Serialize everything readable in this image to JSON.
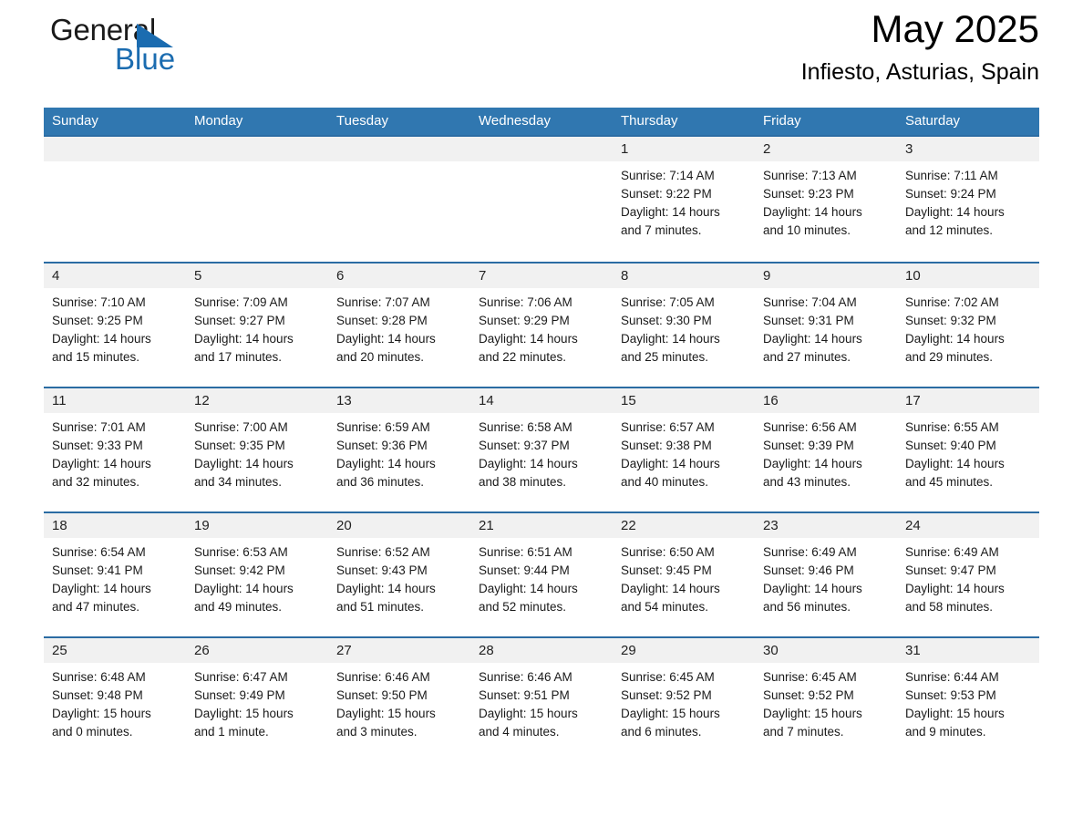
{
  "brand": {
    "name_dark": "General",
    "name_light": "Blue",
    "triangle_color": "#1b6cb0"
  },
  "header": {
    "title": "May 2025",
    "subtitle": "Infiesto, Asturias, Spain",
    "accent_color": "#3077b0",
    "separator_color": "#2b6ca3",
    "day_band_color": "#f1f1f1"
  },
  "weekday_headers": [
    "Sunday",
    "Monday",
    "Tuesday",
    "Wednesday",
    "Thursday",
    "Friday",
    "Saturday"
  ],
  "weeks": [
    {
      "days": [
        {
          "num": "",
          "sunrise": "",
          "sunset": "",
          "daylight_1": "",
          "daylight_2": ""
        },
        {
          "num": "",
          "sunrise": "",
          "sunset": "",
          "daylight_1": "",
          "daylight_2": ""
        },
        {
          "num": "",
          "sunrise": "",
          "sunset": "",
          "daylight_1": "",
          "daylight_2": ""
        },
        {
          "num": "",
          "sunrise": "",
          "sunset": "",
          "daylight_1": "",
          "daylight_2": ""
        },
        {
          "num": "1",
          "sunrise": "Sunrise: 7:14 AM",
          "sunset": "Sunset: 9:22 PM",
          "daylight_1": "Daylight: 14 hours",
          "daylight_2": "and 7 minutes."
        },
        {
          "num": "2",
          "sunrise": "Sunrise: 7:13 AM",
          "sunset": "Sunset: 9:23 PM",
          "daylight_1": "Daylight: 14 hours",
          "daylight_2": "and 10 minutes."
        },
        {
          "num": "3",
          "sunrise": "Sunrise: 7:11 AM",
          "sunset": "Sunset: 9:24 PM",
          "daylight_1": "Daylight: 14 hours",
          "daylight_2": "and 12 minutes."
        }
      ]
    },
    {
      "days": [
        {
          "num": "4",
          "sunrise": "Sunrise: 7:10 AM",
          "sunset": "Sunset: 9:25 PM",
          "daylight_1": "Daylight: 14 hours",
          "daylight_2": "and 15 minutes."
        },
        {
          "num": "5",
          "sunrise": "Sunrise: 7:09 AM",
          "sunset": "Sunset: 9:27 PM",
          "daylight_1": "Daylight: 14 hours",
          "daylight_2": "and 17 minutes."
        },
        {
          "num": "6",
          "sunrise": "Sunrise: 7:07 AM",
          "sunset": "Sunset: 9:28 PM",
          "daylight_1": "Daylight: 14 hours",
          "daylight_2": "and 20 minutes."
        },
        {
          "num": "7",
          "sunrise": "Sunrise: 7:06 AM",
          "sunset": "Sunset: 9:29 PM",
          "daylight_1": "Daylight: 14 hours",
          "daylight_2": "and 22 minutes."
        },
        {
          "num": "8",
          "sunrise": "Sunrise: 7:05 AM",
          "sunset": "Sunset: 9:30 PM",
          "daylight_1": "Daylight: 14 hours",
          "daylight_2": "and 25 minutes."
        },
        {
          "num": "9",
          "sunrise": "Sunrise: 7:04 AM",
          "sunset": "Sunset: 9:31 PM",
          "daylight_1": "Daylight: 14 hours",
          "daylight_2": "and 27 minutes."
        },
        {
          "num": "10",
          "sunrise": "Sunrise: 7:02 AM",
          "sunset": "Sunset: 9:32 PM",
          "daylight_1": "Daylight: 14 hours",
          "daylight_2": "and 29 minutes."
        }
      ]
    },
    {
      "days": [
        {
          "num": "11",
          "sunrise": "Sunrise: 7:01 AM",
          "sunset": "Sunset: 9:33 PM",
          "daylight_1": "Daylight: 14 hours",
          "daylight_2": "and 32 minutes."
        },
        {
          "num": "12",
          "sunrise": "Sunrise: 7:00 AM",
          "sunset": "Sunset: 9:35 PM",
          "daylight_1": "Daylight: 14 hours",
          "daylight_2": "and 34 minutes."
        },
        {
          "num": "13",
          "sunrise": "Sunrise: 6:59 AM",
          "sunset": "Sunset: 9:36 PM",
          "daylight_1": "Daylight: 14 hours",
          "daylight_2": "and 36 minutes."
        },
        {
          "num": "14",
          "sunrise": "Sunrise: 6:58 AM",
          "sunset": "Sunset: 9:37 PM",
          "daylight_1": "Daylight: 14 hours",
          "daylight_2": "and 38 minutes."
        },
        {
          "num": "15",
          "sunrise": "Sunrise: 6:57 AM",
          "sunset": "Sunset: 9:38 PM",
          "daylight_1": "Daylight: 14 hours",
          "daylight_2": "and 40 minutes."
        },
        {
          "num": "16",
          "sunrise": "Sunrise: 6:56 AM",
          "sunset": "Sunset: 9:39 PM",
          "daylight_1": "Daylight: 14 hours",
          "daylight_2": "and 43 minutes."
        },
        {
          "num": "17",
          "sunrise": "Sunrise: 6:55 AM",
          "sunset": "Sunset: 9:40 PM",
          "daylight_1": "Daylight: 14 hours",
          "daylight_2": "and 45 minutes."
        }
      ]
    },
    {
      "days": [
        {
          "num": "18",
          "sunrise": "Sunrise: 6:54 AM",
          "sunset": "Sunset: 9:41 PM",
          "daylight_1": "Daylight: 14 hours",
          "daylight_2": "and 47 minutes."
        },
        {
          "num": "19",
          "sunrise": "Sunrise: 6:53 AM",
          "sunset": "Sunset: 9:42 PM",
          "daylight_1": "Daylight: 14 hours",
          "daylight_2": "and 49 minutes."
        },
        {
          "num": "20",
          "sunrise": "Sunrise: 6:52 AM",
          "sunset": "Sunset: 9:43 PM",
          "daylight_1": "Daylight: 14 hours",
          "daylight_2": "and 51 minutes."
        },
        {
          "num": "21",
          "sunrise": "Sunrise: 6:51 AM",
          "sunset": "Sunset: 9:44 PM",
          "daylight_1": "Daylight: 14 hours",
          "daylight_2": "and 52 minutes."
        },
        {
          "num": "22",
          "sunrise": "Sunrise: 6:50 AM",
          "sunset": "Sunset: 9:45 PM",
          "daylight_1": "Daylight: 14 hours",
          "daylight_2": "and 54 minutes."
        },
        {
          "num": "23",
          "sunrise": "Sunrise: 6:49 AM",
          "sunset": "Sunset: 9:46 PM",
          "daylight_1": "Daylight: 14 hours",
          "daylight_2": "and 56 minutes."
        },
        {
          "num": "24",
          "sunrise": "Sunrise: 6:49 AM",
          "sunset": "Sunset: 9:47 PM",
          "daylight_1": "Daylight: 14 hours",
          "daylight_2": "and 58 minutes."
        }
      ]
    },
    {
      "days": [
        {
          "num": "25",
          "sunrise": "Sunrise: 6:48 AM",
          "sunset": "Sunset: 9:48 PM",
          "daylight_1": "Daylight: 15 hours",
          "daylight_2": "and 0 minutes."
        },
        {
          "num": "26",
          "sunrise": "Sunrise: 6:47 AM",
          "sunset": "Sunset: 9:49 PM",
          "daylight_1": "Daylight: 15 hours",
          "daylight_2": "and 1 minute."
        },
        {
          "num": "27",
          "sunrise": "Sunrise: 6:46 AM",
          "sunset": "Sunset: 9:50 PM",
          "daylight_1": "Daylight: 15 hours",
          "daylight_2": "and 3 minutes."
        },
        {
          "num": "28",
          "sunrise": "Sunrise: 6:46 AM",
          "sunset": "Sunset: 9:51 PM",
          "daylight_1": "Daylight: 15 hours",
          "daylight_2": "and 4 minutes."
        },
        {
          "num": "29",
          "sunrise": "Sunrise: 6:45 AM",
          "sunset": "Sunset: 9:52 PM",
          "daylight_1": "Daylight: 15 hours",
          "daylight_2": "and 6 minutes."
        },
        {
          "num": "30",
          "sunrise": "Sunrise: 6:45 AM",
          "sunset": "Sunset: 9:52 PM",
          "daylight_1": "Daylight: 15 hours",
          "daylight_2": "and 7 minutes."
        },
        {
          "num": "31",
          "sunrise": "Sunrise: 6:44 AM",
          "sunset": "Sunset: 9:53 PM",
          "daylight_1": "Daylight: 15 hours",
          "daylight_2": "and 9 minutes."
        }
      ]
    }
  ]
}
